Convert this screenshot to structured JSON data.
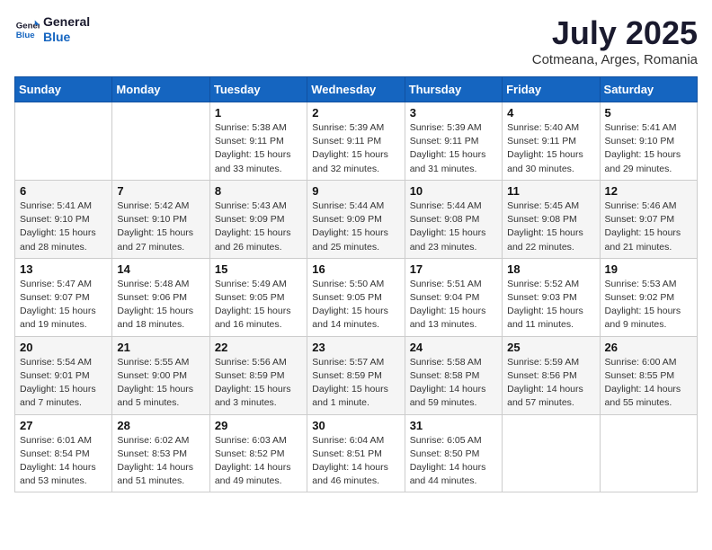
{
  "header": {
    "logo": {
      "line1": "General",
      "line2": "Blue"
    },
    "month": "July 2025",
    "location": "Cotmeana, Arges, Romania"
  },
  "weekdays": [
    "Sunday",
    "Monday",
    "Tuesday",
    "Wednesday",
    "Thursday",
    "Friday",
    "Saturday"
  ],
  "weeks": [
    [
      {
        "day": "",
        "info": ""
      },
      {
        "day": "",
        "info": ""
      },
      {
        "day": "1",
        "info": "Sunrise: 5:38 AM\nSunset: 9:11 PM\nDaylight: 15 hours\nand 33 minutes."
      },
      {
        "day": "2",
        "info": "Sunrise: 5:39 AM\nSunset: 9:11 PM\nDaylight: 15 hours\nand 32 minutes."
      },
      {
        "day": "3",
        "info": "Sunrise: 5:39 AM\nSunset: 9:11 PM\nDaylight: 15 hours\nand 31 minutes."
      },
      {
        "day": "4",
        "info": "Sunrise: 5:40 AM\nSunset: 9:11 PM\nDaylight: 15 hours\nand 30 minutes."
      },
      {
        "day": "5",
        "info": "Sunrise: 5:41 AM\nSunset: 9:10 PM\nDaylight: 15 hours\nand 29 minutes."
      }
    ],
    [
      {
        "day": "6",
        "info": "Sunrise: 5:41 AM\nSunset: 9:10 PM\nDaylight: 15 hours\nand 28 minutes."
      },
      {
        "day": "7",
        "info": "Sunrise: 5:42 AM\nSunset: 9:10 PM\nDaylight: 15 hours\nand 27 minutes."
      },
      {
        "day": "8",
        "info": "Sunrise: 5:43 AM\nSunset: 9:09 PM\nDaylight: 15 hours\nand 26 minutes."
      },
      {
        "day": "9",
        "info": "Sunrise: 5:44 AM\nSunset: 9:09 PM\nDaylight: 15 hours\nand 25 minutes."
      },
      {
        "day": "10",
        "info": "Sunrise: 5:44 AM\nSunset: 9:08 PM\nDaylight: 15 hours\nand 23 minutes."
      },
      {
        "day": "11",
        "info": "Sunrise: 5:45 AM\nSunset: 9:08 PM\nDaylight: 15 hours\nand 22 minutes."
      },
      {
        "day": "12",
        "info": "Sunrise: 5:46 AM\nSunset: 9:07 PM\nDaylight: 15 hours\nand 21 minutes."
      }
    ],
    [
      {
        "day": "13",
        "info": "Sunrise: 5:47 AM\nSunset: 9:07 PM\nDaylight: 15 hours\nand 19 minutes."
      },
      {
        "day": "14",
        "info": "Sunrise: 5:48 AM\nSunset: 9:06 PM\nDaylight: 15 hours\nand 18 minutes."
      },
      {
        "day": "15",
        "info": "Sunrise: 5:49 AM\nSunset: 9:05 PM\nDaylight: 15 hours\nand 16 minutes."
      },
      {
        "day": "16",
        "info": "Sunrise: 5:50 AM\nSunset: 9:05 PM\nDaylight: 15 hours\nand 14 minutes."
      },
      {
        "day": "17",
        "info": "Sunrise: 5:51 AM\nSunset: 9:04 PM\nDaylight: 15 hours\nand 13 minutes."
      },
      {
        "day": "18",
        "info": "Sunrise: 5:52 AM\nSunset: 9:03 PM\nDaylight: 15 hours\nand 11 minutes."
      },
      {
        "day": "19",
        "info": "Sunrise: 5:53 AM\nSunset: 9:02 PM\nDaylight: 15 hours\nand 9 minutes."
      }
    ],
    [
      {
        "day": "20",
        "info": "Sunrise: 5:54 AM\nSunset: 9:01 PM\nDaylight: 15 hours\nand 7 minutes."
      },
      {
        "day": "21",
        "info": "Sunrise: 5:55 AM\nSunset: 9:00 PM\nDaylight: 15 hours\nand 5 minutes."
      },
      {
        "day": "22",
        "info": "Sunrise: 5:56 AM\nSunset: 8:59 PM\nDaylight: 15 hours\nand 3 minutes."
      },
      {
        "day": "23",
        "info": "Sunrise: 5:57 AM\nSunset: 8:59 PM\nDaylight: 15 hours\nand 1 minute."
      },
      {
        "day": "24",
        "info": "Sunrise: 5:58 AM\nSunset: 8:58 PM\nDaylight: 14 hours\nand 59 minutes."
      },
      {
        "day": "25",
        "info": "Sunrise: 5:59 AM\nSunset: 8:56 PM\nDaylight: 14 hours\nand 57 minutes."
      },
      {
        "day": "26",
        "info": "Sunrise: 6:00 AM\nSunset: 8:55 PM\nDaylight: 14 hours\nand 55 minutes."
      }
    ],
    [
      {
        "day": "27",
        "info": "Sunrise: 6:01 AM\nSunset: 8:54 PM\nDaylight: 14 hours\nand 53 minutes."
      },
      {
        "day": "28",
        "info": "Sunrise: 6:02 AM\nSunset: 8:53 PM\nDaylight: 14 hours\nand 51 minutes."
      },
      {
        "day": "29",
        "info": "Sunrise: 6:03 AM\nSunset: 8:52 PM\nDaylight: 14 hours\nand 49 minutes."
      },
      {
        "day": "30",
        "info": "Sunrise: 6:04 AM\nSunset: 8:51 PM\nDaylight: 14 hours\nand 46 minutes."
      },
      {
        "day": "31",
        "info": "Sunrise: 6:05 AM\nSunset: 8:50 PM\nDaylight: 14 hours\nand 44 minutes."
      },
      {
        "day": "",
        "info": ""
      },
      {
        "day": "",
        "info": ""
      }
    ]
  ]
}
